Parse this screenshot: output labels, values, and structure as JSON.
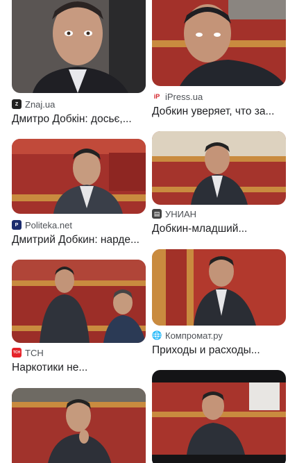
{
  "results": {
    "left": [
      {
        "source": "Znaj.ua",
        "title": "Дмитро Добкін: досьє,...",
        "favicon": "znaj-favicon",
        "image": "Portrait of man in dark suit"
      },
      {
        "source": "Politeka.net",
        "title": "Дмитрий Добкин: нарде...",
        "favicon": "politeka-favicon",
        "image": "Man seated in red parliament seats"
      },
      {
        "source": "ТСН",
        "title": "Наркотики не...",
        "favicon": "tsn-favicon",
        "image": "Two men seated in parliament"
      },
      {
        "source": "",
        "title": "",
        "favicon": "",
        "image": "Man with hand on chin in parliament"
      }
    ],
    "right": [
      {
        "source": "iPress.ua",
        "title": "Добкин уверяет, что за...",
        "favicon": "ipress-favicon",
        "image": "Man close-up glancing sideways"
      },
      {
        "source": "УНИАН",
        "title": "Добкин-младший...",
        "favicon": "unian-favicon",
        "image": "Man seated in parliament hall"
      },
      {
        "source": "Компромат.ру",
        "title": "Приходы и расходы...",
        "favicon": "globe-icon",
        "image": "Man in parliament with red seats"
      },
      {
        "source": "",
        "title": "",
        "favicon": "",
        "image": "Man reclining in parliament seats"
      }
    ]
  },
  "favicon_text": {
    "znaj": "Z",
    "ipress": "iP",
    "politeka": "P",
    "unian": "▤",
    "tsn": "ТСН"
  },
  "colors": {
    "seat_red": "#b3312a",
    "wood": "#c98b3f",
    "suit_dark": "#2c2f36",
    "skin": "#c99b7e",
    "znaj": "#222222",
    "ipress": "#d32027",
    "politeka": "#1a2b6d",
    "unian": "#444444",
    "tsn": "#e5232a"
  }
}
